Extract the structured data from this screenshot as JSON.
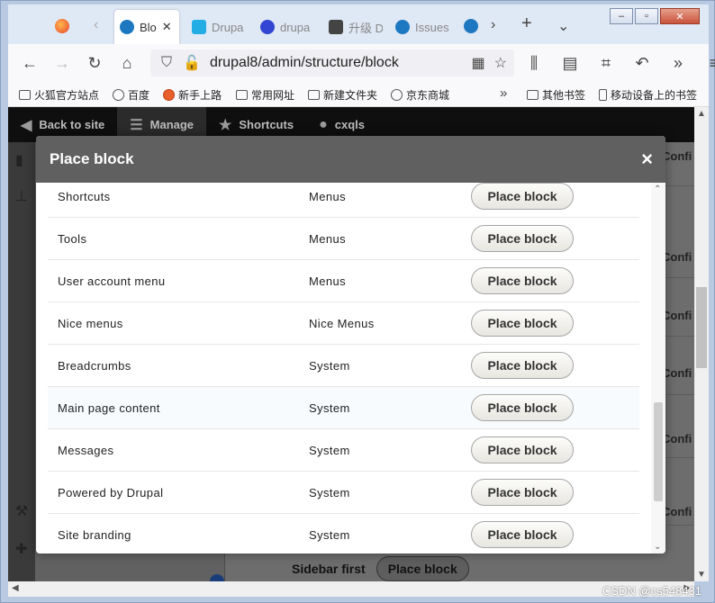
{
  "browser": {
    "tabs": [
      {
        "label": "Blo",
        "active": true
      },
      {
        "label": "Drupa"
      },
      {
        "label": "drupa"
      },
      {
        "label": "升级 D"
      },
      {
        "label": "Issues"
      }
    ],
    "url": "drupal8/admin/structure/block",
    "bookmarks": [
      "火狐官方站点",
      "百度",
      "新手上路",
      "常用网址",
      "新建文件夹",
      "京东商城",
      "其他书签",
      "移动设备上的书签"
    ]
  },
  "toolbar": {
    "back": "Back to site",
    "manage": "Manage",
    "shortcuts": "Shortcuts",
    "user": "cxqls"
  },
  "background": {
    "conf_label": "Confi",
    "sidebar_label": "Sidebar first",
    "place_block": "Place block"
  },
  "modal": {
    "title": "Place block",
    "close_symbol": "×",
    "button_label": "Place block",
    "rows": [
      {
        "name": "Shortcuts",
        "category": "Menus"
      },
      {
        "name": "Tools",
        "category": "Menus"
      },
      {
        "name": "User account menu",
        "category": "Menus"
      },
      {
        "name": "Nice menus",
        "category": "Nice Menus"
      },
      {
        "name": "Breadcrumbs",
        "category": "System"
      },
      {
        "name": "Main page content",
        "category": "System"
      },
      {
        "name": "Messages",
        "category": "System"
      },
      {
        "name": "Powered by Drupal",
        "category": "System"
      },
      {
        "name": "Site branding",
        "category": "System"
      }
    ]
  },
  "watermark": "CSDN @cs548431"
}
